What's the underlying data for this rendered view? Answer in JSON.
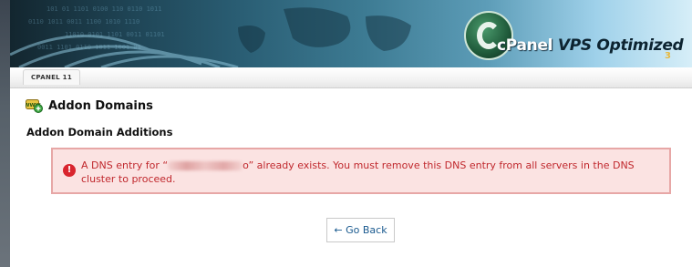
{
  "banner": {
    "brand": "cPanel",
    "product": "VPS Optimized",
    "version_mark": "3"
  },
  "tab": {
    "label": "CPANEL 11"
  },
  "page": {
    "title": "Addon Domains",
    "section_title": "Addon Domain Additions"
  },
  "alert": {
    "icon": "!",
    "text_before": "A DNS entry for “",
    "text_after": "o” already exists. You must remove this DNS entry from all servers in the DNS cluster to proceed."
  },
  "actions": {
    "go_back_label": "← Go Back"
  },
  "colors": {
    "alert_bg": "#fbe3e2",
    "alert_border": "#e7a7a6",
    "alert_text": "#c0282d",
    "link": "#1a5a8f"
  }
}
